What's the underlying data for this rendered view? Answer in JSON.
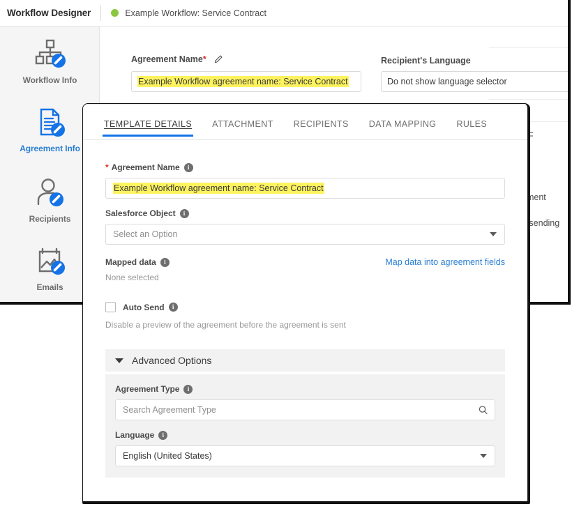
{
  "app": {
    "title": "Workflow Designer",
    "workflow_name": "Example Workflow: Service Contract",
    "status_color": "#8bc63f"
  },
  "sidebar": {
    "items": [
      {
        "label": "Workflow Info",
        "icon": "org-chart-edit-icon",
        "active": false
      },
      {
        "label": "Agreement Info",
        "icon": "document-edit-icon",
        "active": true
      },
      {
        "label": "Recipients",
        "icon": "person-edit-icon",
        "active": false
      },
      {
        "label": "Emails",
        "icon": "image-edit-icon",
        "active": false
      }
    ]
  },
  "background_form": {
    "agreement_name_label": "Agreement Name",
    "required_mark": "*",
    "edit_icon": "pencil-icon",
    "agreement_name_value": "Example Workflow agreement name: Service Contract",
    "recipients_language_label": "Recipient's Language",
    "recipients_language_value": "Do not show language selector",
    "obscured_fragments": [
      "DF",
      "ement",
      "o sending"
    ]
  },
  "modal": {
    "tabs": [
      {
        "label": "TEMPLATE DETAILS",
        "active": true
      },
      {
        "label": "ATTACHMENT",
        "active": false
      },
      {
        "label": "RECIPIENTS",
        "active": false
      },
      {
        "label": "DATA MAPPING",
        "active": false
      },
      {
        "label": "RULES",
        "active": false
      }
    ],
    "agreement_name": {
      "label": "Agreement Name",
      "required_mark": "*",
      "info_icon": "info-icon",
      "value": "Example Workflow agreement name: Service Contract"
    },
    "salesforce_object": {
      "label": "Salesforce Object",
      "info_icon": "info-icon",
      "value": "Select an Option",
      "caret_icon": "chevron-down-icon"
    },
    "mapped_data": {
      "label": "Mapped data",
      "info_icon": "info-icon",
      "value": "None selected",
      "link_label": "Map data into agreement fields"
    },
    "auto_send": {
      "label": "Auto Send",
      "info_icon": "info-icon",
      "checked": false,
      "description": "Disable a preview of the agreement before the agreement is sent"
    },
    "advanced_options": {
      "title": "Advanced Options",
      "chevron_icon": "chevron-down-icon",
      "agreement_type": {
        "label": "Agreement Type",
        "info_icon": "info-icon",
        "placeholder": "Search Agreement Type",
        "search_icon": "search-icon"
      },
      "language": {
        "label": "Language",
        "info_icon": "info-icon",
        "value": "English (United States)",
        "caret_icon": "chevron-down-icon"
      }
    }
  },
  "colors": {
    "accent_blue": "#1473e6",
    "link_blue": "#2a7fd4",
    "highlight_yellow": "#fdf35f",
    "required_red": "#d93025",
    "status_green": "#8bc63f"
  }
}
